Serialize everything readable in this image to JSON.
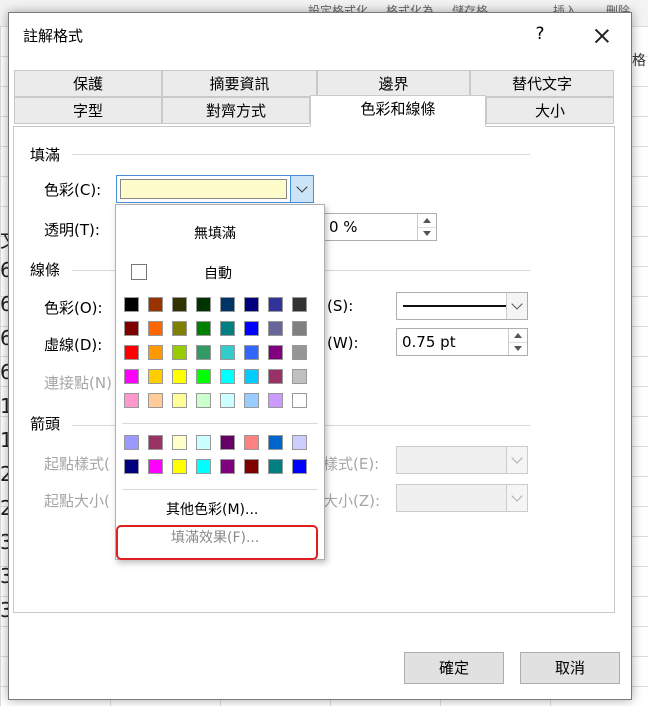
{
  "background": {
    "ribbon_text_1": "設定格式化",
    "ribbon_text_2": "格式化為",
    "ribbon_text_3": "儲存格",
    "ribbon_insert": "插入",
    "ribbon_delete": "刪除",
    "right_text": "格",
    "row_digits": [
      "文",
      "6",
      "6",
      "6",
      "6",
      "1",
      "1",
      "2",
      "2",
      "3",
      "3",
      "3"
    ]
  },
  "dialog": {
    "title": "註解格式",
    "help": "?",
    "tabs_row1": [
      "保護",
      "摘要資訊",
      "邊界",
      "替代文字"
    ],
    "tabs_row2": [
      "字型",
      "對齊方式",
      "色彩和線條",
      "大小"
    ],
    "active_tab": "色彩和線條",
    "fill": {
      "section": "填滿",
      "color_label": "色彩(C):",
      "transparency_label": "透明(T):",
      "transparency_value": "0 %",
      "color_value": "#fffccc"
    },
    "line": {
      "section": "線條",
      "color_label": "色彩(O):",
      "dash_label": "虛線(D):",
      "connector_label": "連接點(N)",
      "style_label": "(S):",
      "weight_label": "(W):",
      "weight_value": "0.75 pt"
    },
    "arrows": {
      "section": "箭頭",
      "begin_style_label": "起點樣式(",
      "begin_size_label": "起點大小(",
      "end_style_label": "樣式(E):",
      "end_size_label": "大小(Z):"
    },
    "ok": "確定",
    "cancel": "取消"
  },
  "dropdown": {
    "no_fill": "無填滿",
    "automatic": "自動",
    "more_colors": "其他色彩(M)...",
    "fill_effects": "填滿效果(F)...",
    "colors_main": [
      [
        "#000000",
        "#993300",
        "#333300",
        "#003300",
        "#003366",
        "#000080",
        "#333399",
        "#333333"
      ],
      [
        "#800000",
        "#ff6600",
        "#808000",
        "#008000",
        "#008080",
        "#0000ff",
        "#666699",
        "#808080"
      ],
      [
        "#ff0000",
        "#ff9900",
        "#99cc00",
        "#339966",
        "#33cccc",
        "#3366ff",
        "#800080",
        "#969696"
      ],
      [
        "#ff00ff",
        "#ffcc00",
        "#ffff00",
        "#00ff00",
        "#00ffff",
        "#00ccff",
        "#993366",
        "#c0c0c0"
      ],
      [
        "#ff99cc",
        "#ffcc99",
        "#ffff99",
        "#ccffcc",
        "#ccffff",
        "#99ccff",
        "#cc99ff",
        "#ffffff"
      ]
    ],
    "colors_extra": [
      [
        "#9999ff",
        "#993366",
        "#ffffcc",
        "#ccffff",
        "#660066",
        "#ff8080",
        "#0066cc",
        "#ccccff"
      ],
      [
        "#000080",
        "#ff00ff",
        "#ffff00",
        "#00ffff",
        "#800080",
        "#800000",
        "#008080",
        "#0000ff"
      ]
    ]
  }
}
